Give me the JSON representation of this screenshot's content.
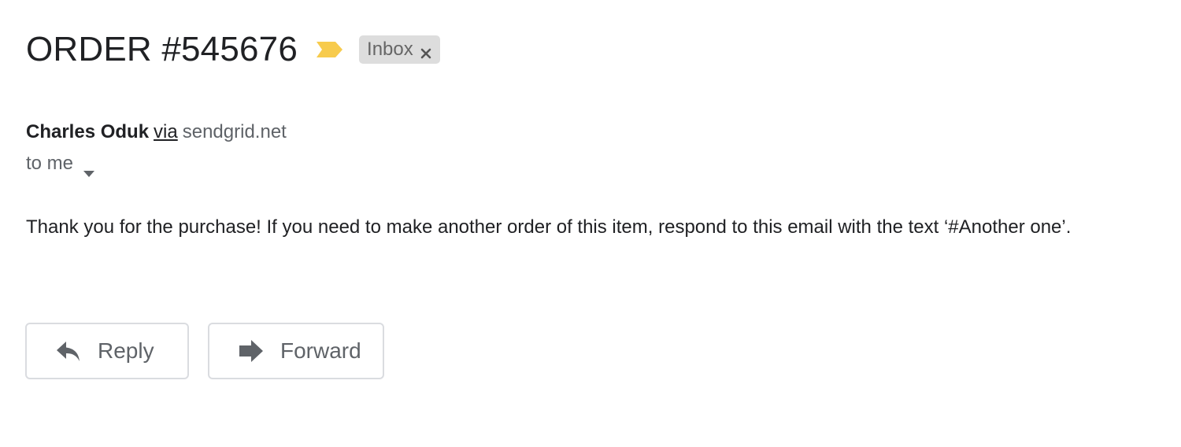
{
  "email": {
    "subject": "ORDER #545676",
    "importance_icon": "importance-marker-icon",
    "label": {
      "text": "Inbox",
      "close_icon": "close-icon"
    },
    "sender": {
      "name": "Charles Oduk",
      "via_label": "via",
      "via_domain": "sendgrid.net"
    },
    "recipient": {
      "text": "to me",
      "dropdown_icon": "chevron-down-icon"
    },
    "body": "Thank you for the purchase! If you need to make another order of this item, respond to this email with the text ‘#Another one’."
  },
  "actions": {
    "reply_label": "Reply",
    "reply_icon": "reply-icon",
    "forward_label": "Forward",
    "forward_icon": "forward-icon"
  },
  "colors": {
    "importance": "#f7cb4d",
    "label_chip_bg": "#dddddd",
    "text_primary": "#202124",
    "text_secondary": "#5f6368",
    "button_border": "#dadce0"
  }
}
